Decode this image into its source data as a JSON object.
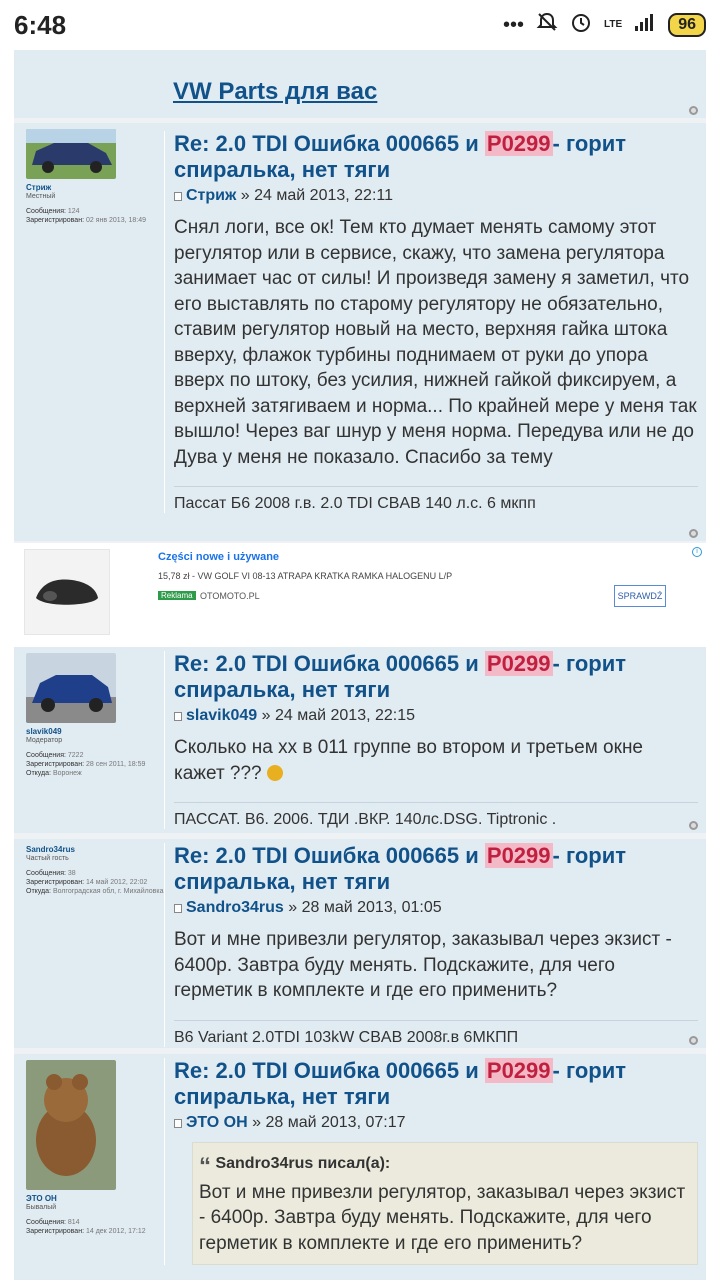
{
  "status": {
    "time": "6:48",
    "network": "LTE",
    "battery": "96"
  },
  "top_link": {
    "label": "VW Parts для вас"
  },
  "posts": [
    {
      "title_pre": "Re: 2.0 TDI Ошибка 000665 и ",
      "title_hl": "P0299",
      "title_post": "- горит спиралька, нет тяги",
      "author": "Стриж",
      "date": "» 24 май 2013, 22:11",
      "content": "Снял логи, все ок! Тем кто думает менять самому этот регулятор или в сервисе, скажу, что замена регулятора занимает час от силы! И произведя замену я заметил, что его выставлять по старому регулятору не обязательно, ставим регулятор новый на место, верхняя гайка штока вверху, флажок турбины поднимаем от руки до упора вверх по штоку, без усилия, нижней гайкой фиксируем, а верхней затягиваем и норма... По крайней мере у меня так вышло! Через ваг шнур у меня норма. Передува или не до Дува у меня не показало. Спасибо за тему",
      "signature": "Пассат Б6 2008 г.в. 2.0 TDI CBAB 140 л.с. 6 мкпп",
      "profile": {
        "name": "Стриж",
        "rank": "Местный",
        "stat1_k": "Сообщения:",
        "stat1_v": "124",
        "stat2_k": "Зарегистрирован:",
        "stat2_v": "02 янв 2013, 18:49",
        "stat3_k": "",
        "stat3_v": ""
      }
    },
    {
      "title_pre": "Re: 2.0 TDI Ошибка 000665 и ",
      "title_hl": "P0299",
      "title_post": "- горит спиралька, нет тяги",
      "author": "slavik049",
      "date": "» 24 май 2013, 22:15",
      "content": "Сколько на хх в 011 группе во втором и третьем окне кажет ???",
      "signature": "ПАССАТ. В6. 2006. ТДИ .ВКР. 140лс.DSG. Tiptronic .",
      "profile": {
        "name": "slavik049",
        "rank": "Модератор",
        "stat1_k": "Сообщения:",
        "stat1_v": "7222",
        "stat2_k": "Зарегистрирован:",
        "stat2_v": "28 сен 2011, 18:59",
        "stat3_k": "Откуда:",
        "stat3_v": "Воронеж"
      }
    },
    {
      "title_pre": "Re: 2.0 TDI Ошибка 000665 и ",
      "title_hl": "P0299",
      "title_post": "- горит спиралька, нет тяги",
      "author": "Sandro34rus",
      "date": "» 28 май 2013, 01:05",
      "content": "Вот и мне привезли регулятор, заказывал через экзист - 6400р. Завтра буду менять. Подскажите, для чего герметик в комплекте и где его применить?",
      "signature": "B6 Variant 2.0TDI 103kW CBAB 2008г.в 6МКПП",
      "profile": {
        "name": "Sandro34rus",
        "rank": "Частый гость",
        "stat1_k": "Сообщения:",
        "stat1_v": "38",
        "stat2_k": "Зарегистрирован:",
        "stat2_v": "14 май 2012, 22:02",
        "stat3_k": "Откуда:",
        "stat3_v": "Волгоградская обл, г. Михайловка"
      }
    },
    {
      "title_pre": "Re: 2.0 TDI Ошибка 000665 и ",
      "title_hl": "P0299",
      "title_post": "- горит спиралька, нет тяги",
      "author": "ЭТО ОН",
      "date": "» 28 май 2013, 07:17",
      "quote_cite": "Sandro34rus писал(а):",
      "quote_text": "Вот и мне привезли регулятор, заказывал через экзист - 6400р. Завтра буду менять. Подскажите, для чего герметик в комплекте и где его применить?",
      "profile": {
        "name": "ЭТО ОН",
        "rank": "Бывалый",
        "stat1_k": "Сообщения:",
        "stat1_v": "814",
        "stat2_k": "Зарегистрирован:",
        "stat2_v": "14 дек 2012, 17:12",
        "stat3_k": "",
        "stat3_v": ""
      }
    }
  ],
  "ad": {
    "headline": "Części nowe i używane",
    "desc": "15,78 zł - VW GOLF VI 08-13 ATRAPA KRATKA RAMKA HALOGENU L/P",
    "badge": "Reklama",
    "domain": "OTOMOTO.PL",
    "cta": "SPRAWDŹ"
  }
}
